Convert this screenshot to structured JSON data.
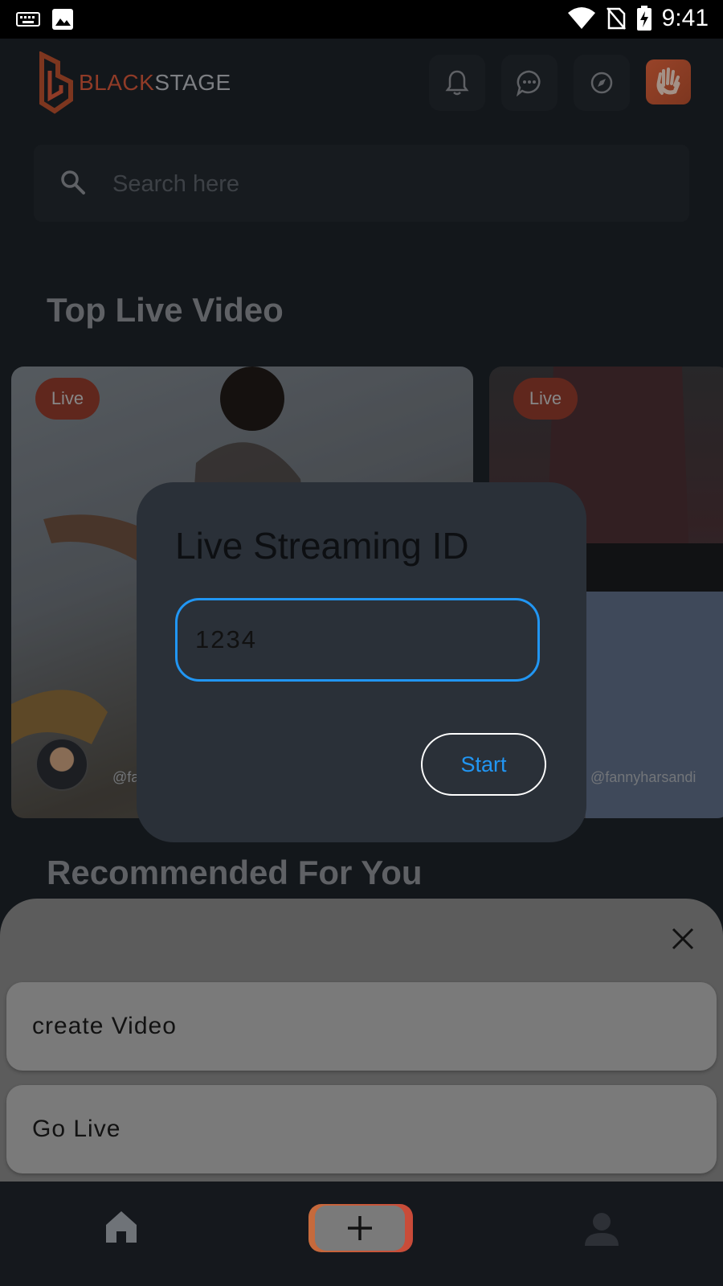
{
  "status_bar": {
    "time": "9:41"
  },
  "header": {
    "logo_part1": "BLACK",
    "logo_part2": "STAGE"
  },
  "search": {
    "placeholder": "Search here"
  },
  "sections": {
    "top_live": "Top Live Video",
    "recommended": "Recommended For You"
  },
  "live_cards": [
    {
      "badge": "Live",
      "username": "@fa"
    },
    {
      "badge": "Live",
      "username": "@fannyharsandi"
    }
  ],
  "dialog": {
    "title": "Live Streaming ID",
    "input_value": "1234",
    "start_label": "Start"
  },
  "sheet": {
    "options": [
      {
        "label": "create Video"
      },
      {
        "label": "Go Live"
      }
    ]
  },
  "colors": {
    "accent": "#2196f3",
    "brand": "#d4573a",
    "live_badge": "#8e3a2c"
  }
}
